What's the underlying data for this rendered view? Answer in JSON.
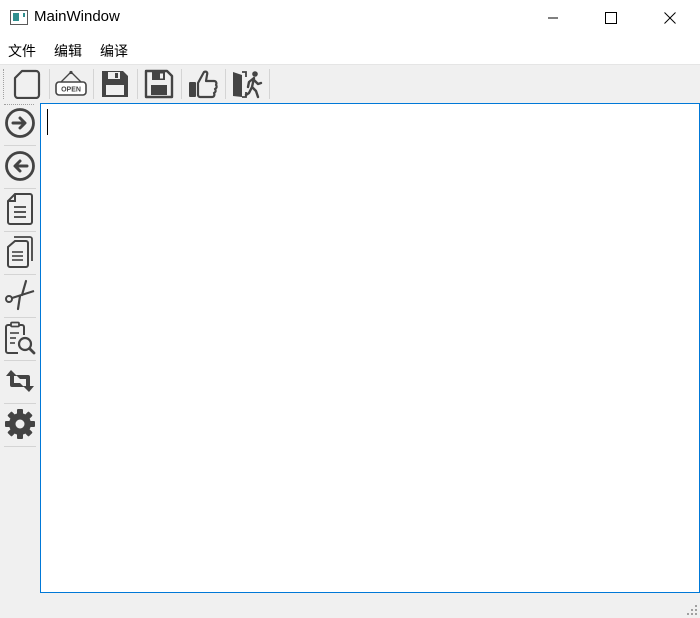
{
  "window": {
    "title": "MainWindow",
    "controls": {
      "minimize": "minimize",
      "maximize": "maximize",
      "close": "close"
    }
  },
  "menubar": {
    "items": [
      {
        "label": "文件"
      },
      {
        "label": "编辑"
      },
      {
        "label": "编译"
      }
    ]
  },
  "toolbar": {
    "buttons": [
      {
        "icon": "new-file-icon"
      },
      {
        "icon": "open-sign-icon",
        "sign_text": "OPEN"
      },
      {
        "icon": "save-icon"
      },
      {
        "icon": "save-as-icon"
      },
      {
        "icon": "thumbs-up-icon"
      },
      {
        "icon": "exit-icon"
      }
    ]
  },
  "side_toolbar": {
    "buttons": [
      {
        "icon": "redo-arrow-right-icon"
      },
      {
        "icon": "undo-arrow-left-icon"
      },
      {
        "icon": "document-icon"
      },
      {
        "icon": "copy-icon"
      },
      {
        "icon": "scissors-icon"
      },
      {
        "icon": "find-icon"
      },
      {
        "icon": "replace-icon"
      },
      {
        "icon": "settings-gear-icon"
      }
    ]
  },
  "editor": {
    "content": ""
  },
  "colors": {
    "icon": "#444444",
    "focus_border": "#0078d7",
    "chrome": "#f0f0f0"
  }
}
